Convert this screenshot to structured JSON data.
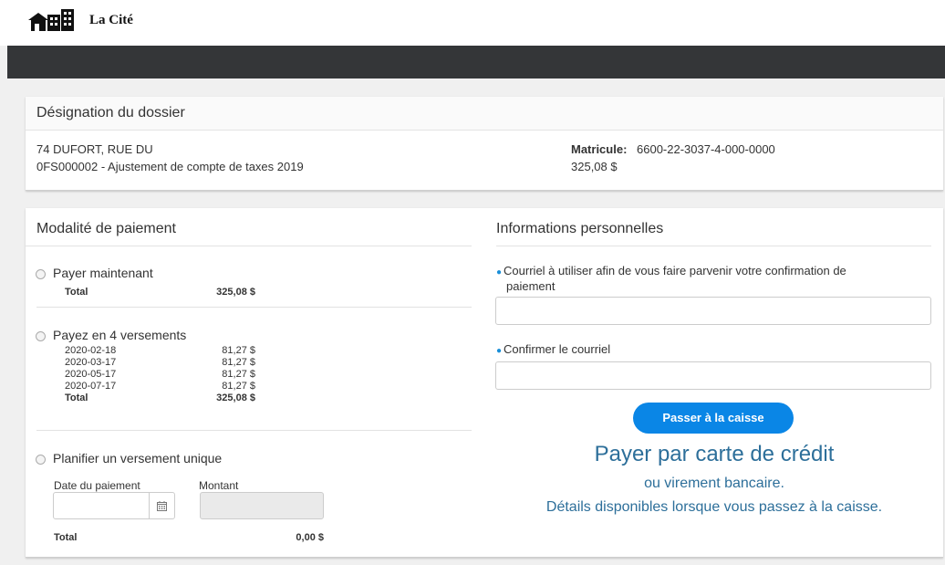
{
  "header": {
    "logo_text": "La Cité"
  },
  "dossier": {
    "title": "Désignation du dossier",
    "address": "74 DUFORT, RUE DU",
    "description": "0FS000002 - Ajustement de compte de taxes 2019",
    "matricule_label": "Matricule:",
    "matricule_value": "6600-22-3037-4-000-0000",
    "amount": "325,08 $"
  },
  "payment": {
    "title": "Modalité de paiement",
    "now": {
      "label": "Payer maintenant",
      "total_label": "Total",
      "total_value": "325,08 $"
    },
    "installments": {
      "label": "Payez en 4 versements",
      "rows": [
        {
          "date": "2020-02-18",
          "amount": "81,27 $"
        },
        {
          "date": "2020-03-17",
          "amount": "81,27 $"
        },
        {
          "date": "2020-05-17",
          "amount": "81,27 $"
        },
        {
          "date": "2020-07-17",
          "amount": "81,27 $"
        }
      ],
      "total_label": "Total",
      "total_value": "325,08 $"
    },
    "single": {
      "label": "Planifier un versement unique",
      "date_label": "Date du paiement",
      "amount_label": "Montant",
      "date_value": "",
      "amount_value": "",
      "total_label": "Total",
      "total_value": "0,00 $"
    }
  },
  "personal": {
    "title": "Informations personnelles",
    "email_label_line1": "Courriel à utiliser afin de vous faire parvenir votre confirmation de",
    "email_label_line2": "paiement",
    "email_value": "",
    "confirm_label": "Confirmer le courriel",
    "confirm_value": "",
    "checkout_button": "Passer à la caisse",
    "pay_card": "Payer par carte de crédit",
    "bank_transfer": "ou virement bancaire.",
    "details": "Détails disponibles lorsque vous passez à la caisse."
  },
  "icons": {
    "logo": "city-buildings-logo",
    "calendar": "calendar-icon",
    "bullet": "blue-dot",
    "radio": "radio-button"
  },
  "colors": {
    "accent": "#0a86e6",
    "navbar": "#343638",
    "highlight_text": "#2d6f9a"
  }
}
